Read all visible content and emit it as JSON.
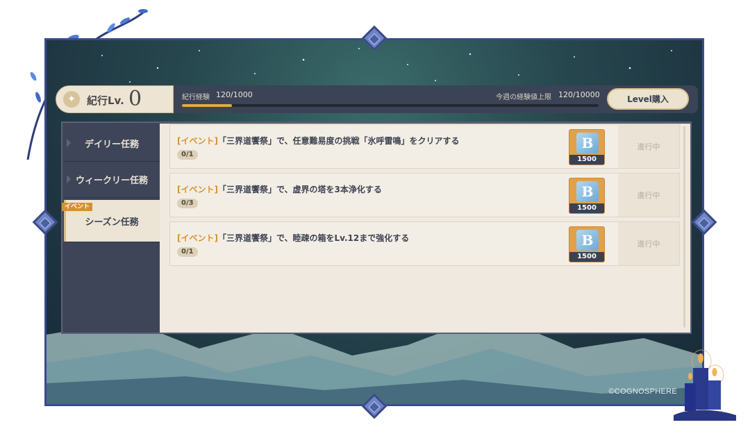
{
  "levelbar": {
    "level_label": "紀行Lv.",
    "level_value": "0",
    "exp_label": "紀行経験",
    "exp_value": "120/1000",
    "exp_progress": 0.12,
    "weekly_label": "今週の経験値上限",
    "weekly_value": "120/10000",
    "buy_button": "Level購入"
  },
  "tabs": [
    {
      "label": "デイリー任務",
      "active": false
    },
    {
      "label": "ウィークリー任務",
      "active": false
    },
    {
      "label": "シーズン任務",
      "active": true,
      "tag": "イベント"
    }
  ],
  "missions": [
    {
      "tag": "[イベント]",
      "text": "「三界道饗祭」で、任意難易度の挑戦「氷呼雷鳴」をクリアする",
      "progress": "0/1",
      "reward_count": "1500",
      "status": "進行中"
    },
    {
      "tag": "[イベント]",
      "text": "「三界道饗祭」で、虚界の塔を3本浄化する",
      "progress": "0/3",
      "reward_count": "1500",
      "status": "進行中"
    },
    {
      "tag": "[イベント]",
      "text": "「三界道饗祭」で、睦疎の箱をLv.12まで強化する",
      "progress": "0/1",
      "reward_count": "1500",
      "status": "進行中"
    }
  ],
  "copyright": "©COGNOSPHERE",
  "colors": {
    "accent": "#d9922e",
    "frame": "#3b4a8a",
    "panel": "#3f4558",
    "content": "#efe9df"
  }
}
